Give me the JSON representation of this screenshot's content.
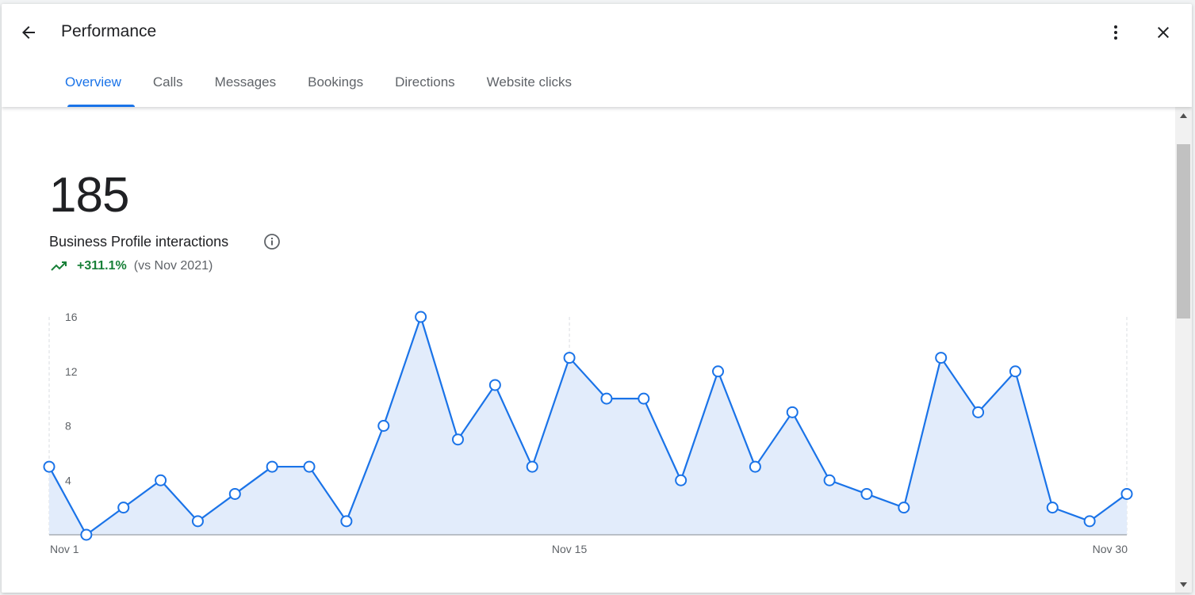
{
  "header": {
    "title": "Performance",
    "back_icon": "arrow-back-icon",
    "more_icon": "more-vert-icon",
    "close_icon": "close-icon"
  },
  "tabs": [
    {
      "label": "Overview",
      "active": true
    },
    {
      "label": "Calls",
      "active": false
    },
    {
      "label": "Messages",
      "active": false
    },
    {
      "label": "Bookings",
      "active": false
    },
    {
      "label": "Directions",
      "active": false
    },
    {
      "label": "Website clicks",
      "active": false
    }
  ],
  "summary": {
    "total": "185",
    "label": "Business Profile interactions",
    "trend_value": "+311.1%",
    "trend_compare": "(vs Nov 2021)"
  },
  "colors": {
    "accent": "#1a73e8",
    "trend_up": "#188038",
    "area_fill": "#e2ecfb"
  },
  "chart_data": {
    "type": "area",
    "x": [
      1,
      2,
      3,
      4,
      5,
      6,
      7,
      8,
      9,
      10,
      11,
      12,
      13,
      14,
      15,
      16,
      17,
      18,
      19,
      20,
      21,
      22,
      23,
      24,
      25,
      26,
      27,
      28,
      29,
      30
    ],
    "values": [
      5,
      0,
      2,
      4,
      1,
      3,
      5,
      5,
      1,
      8,
      16,
      7,
      11,
      5,
      13,
      10,
      10,
      4,
      12,
      5,
      9,
      4,
      3,
      2,
      13,
      9,
      12,
      2,
      1,
      3
    ],
    "x_tick_labels": [
      "Nov 1",
      "Nov 15",
      "Nov 30"
    ],
    "x_tick_positions": [
      1,
      15,
      30
    ],
    "y_ticks": [
      4,
      8,
      12,
      16
    ],
    "ylim": [
      0,
      16
    ],
    "xlim": [
      1,
      30
    ],
    "grid": "vertical dashed at x ticks"
  }
}
